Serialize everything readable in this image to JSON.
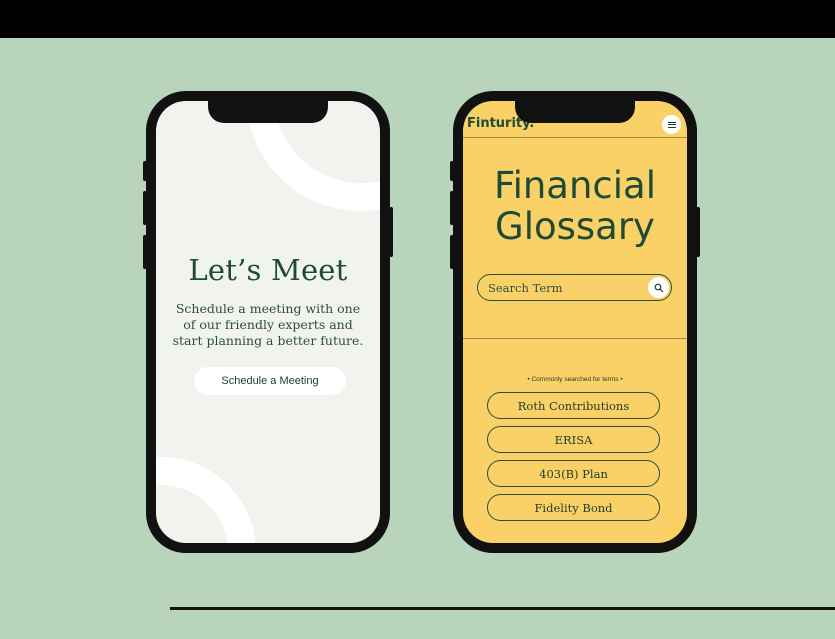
{
  "left_phone": {
    "title": "Let’s Meet",
    "description": "Schedule a meeting with one of our friendly experts and start planning a better future.",
    "button_label": "Schedule a Meeting"
  },
  "right_phone": {
    "brand": "Finturity.",
    "menu_icon": "hamburger-menu-icon",
    "title": "Financial Glossary",
    "search": {
      "placeholder": "Search Term",
      "icon": "search-icon"
    },
    "common_label": "• Commonly searched for terms •",
    "terms": [
      "Roth Contributions",
      "ERISA",
      "403(B) Plan",
      "Fidelity Bond"
    ]
  },
  "colors": {
    "background": "#b8d4bb",
    "dark_green": "#1f4a36",
    "yellow": "#fad166",
    "light_screen": "#f1f3ef"
  }
}
